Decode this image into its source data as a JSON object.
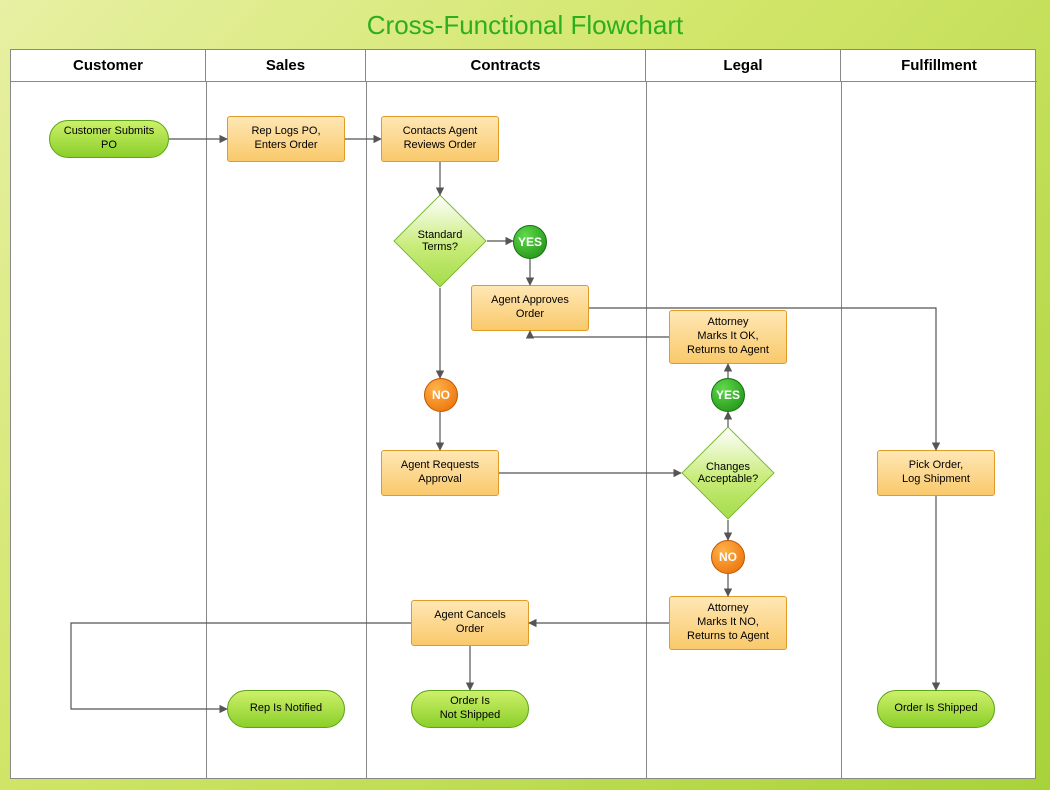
{
  "title": "Cross-Functional Flowchart",
  "lanes": {
    "customer": "Customer",
    "sales": "Sales",
    "contracts": "Contracts",
    "legal": "Legal",
    "fulfillment": "Fulfillment"
  },
  "nodes": {
    "customer_submits": "Customer Submits\nPO",
    "rep_logs": "Rep Logs PO,\nEnters Order",
    "agent_reviews": "Contacts Agent\nReviews Order",
    "standard_terms": "Standard Terms?",
    "yes1": "YES",
    "agent_approves": "Agent Approves\nOrder",
    "no1": "NO",
    "agent_requests": "Agent Requests\nApproval",
    "changes_acceptable": "Changes\nAcceptable?",
    "yes2": "YES",
    "attorney_ok": "Attorney\nMarks It OK,\nReturns to Agent",
    "no2": "NO",
    "attorney_no": "Attorney\nMarks It NO,\nReturns to Agent",
    "agent_cancels": "Agent Cancels\nOrder",
    "order_not_shipped": "Order Is\nNot Shipped",
    "rep_notified": "Rep Is Notified",
    "pick_order": "Pick Order,\nLog Shipment",
    "order_shipped": "Order Is Shipped"
  }
}
